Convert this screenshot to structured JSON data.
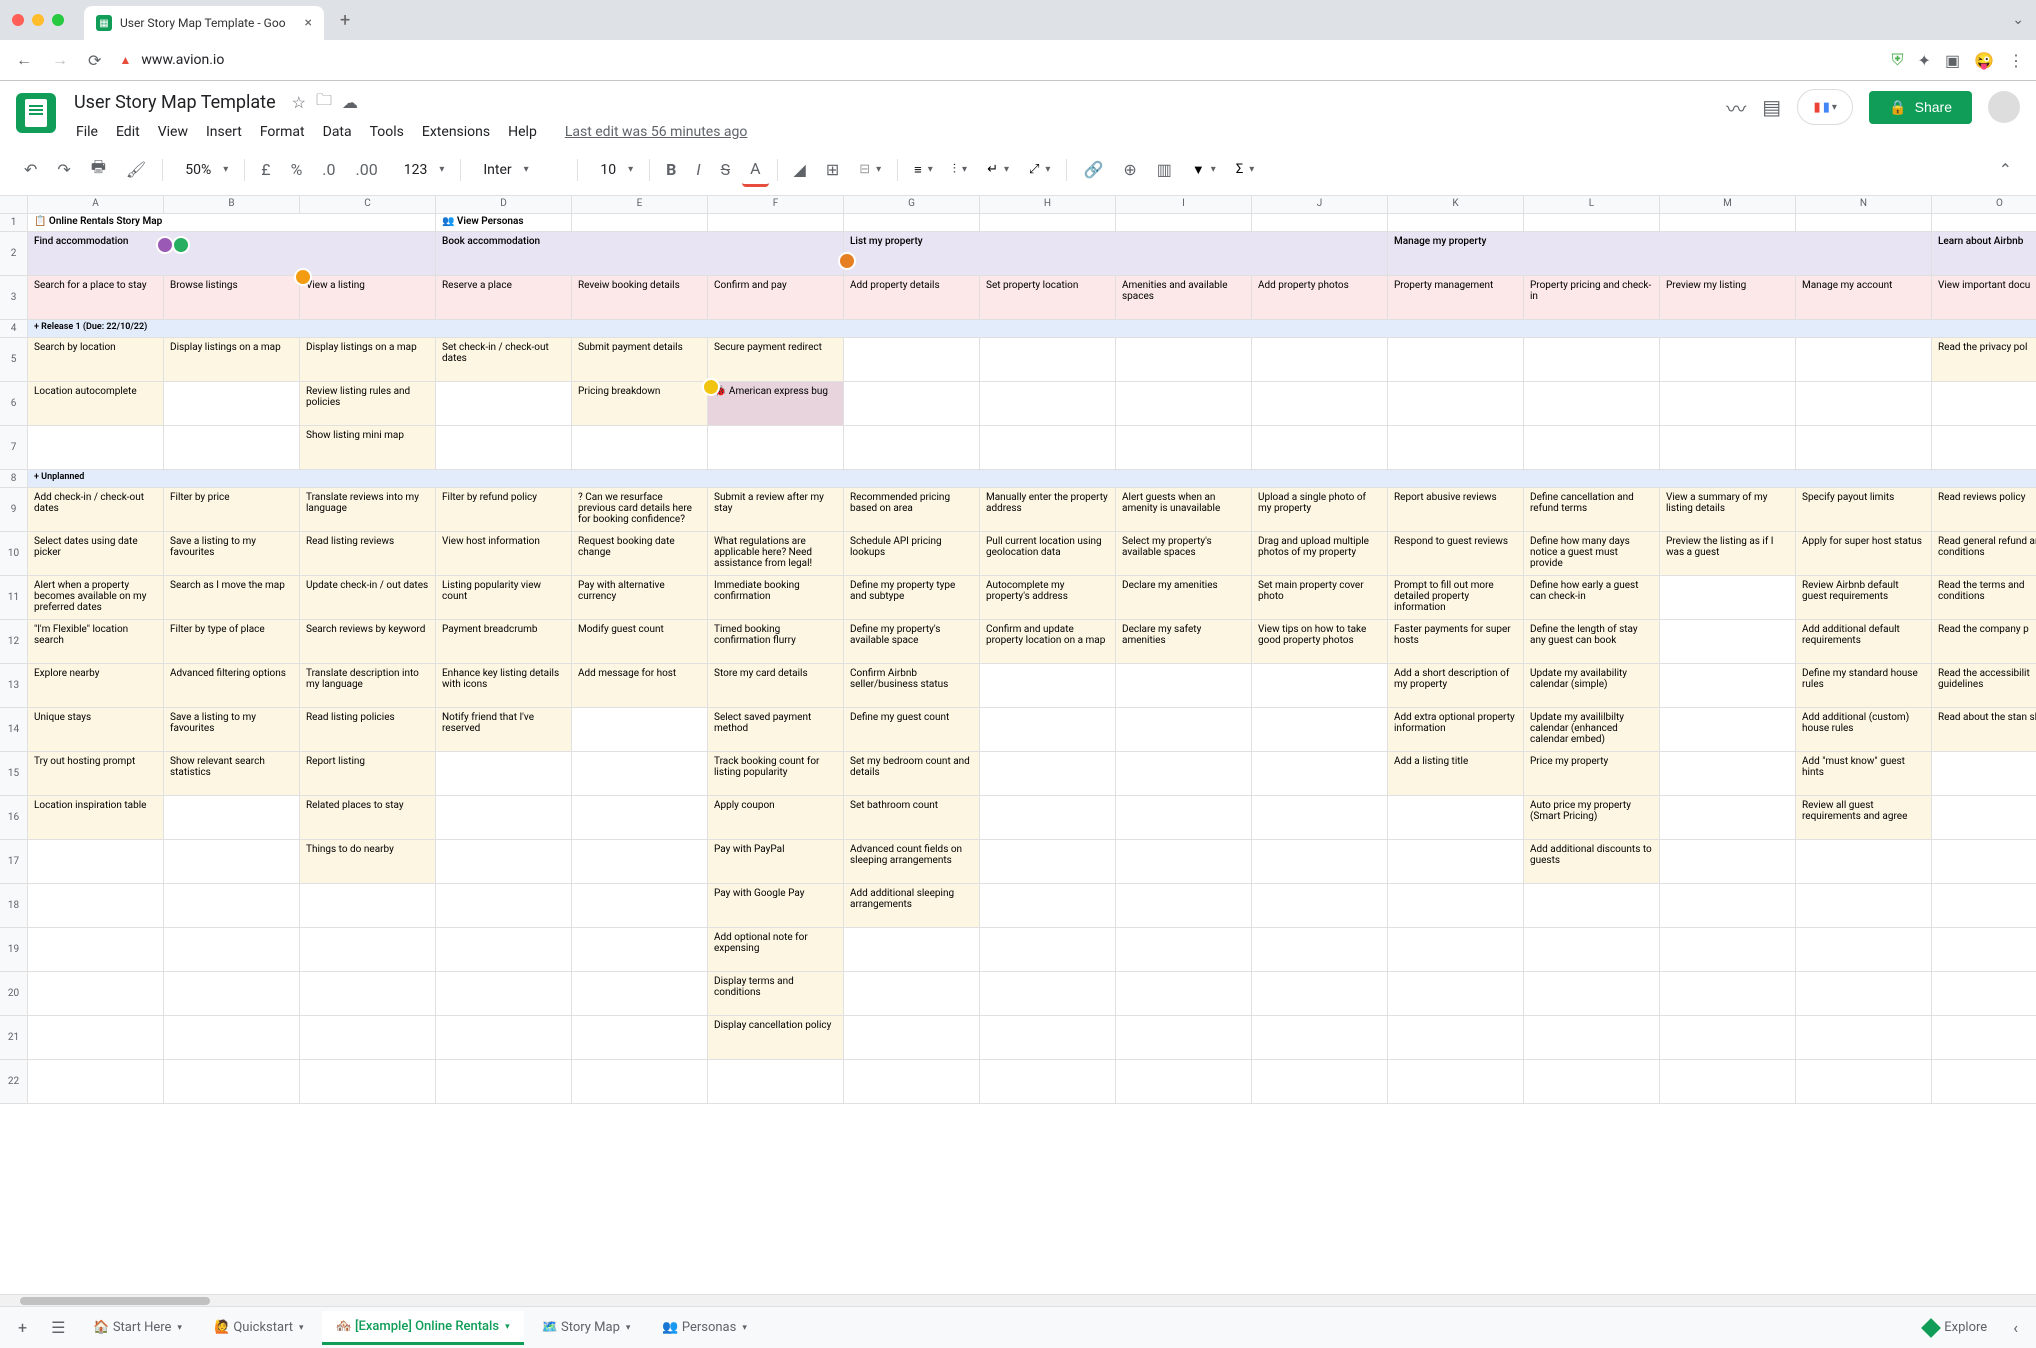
{
  "browser": {
    "tab_title": "User Story Map Template - Goo",
    "url": "www.avion.io"
  },
  "doc": {
    "title": "User Story Map Template",
    "last_edit": "Last edit was 56 minutes ago"
  },
  "menus": [
    "File",
    "Edit",
    "View",
    "Insert",
    "Format",
    "Data",
    "Tools",
    "Extensions",
    "Help"
  ],
  "share_label": "Share",
  "toolbar": {
    "zoom": "50%",
    "currency": "£",
    "percent": "%",
    "dec_dec": ".0",
    "inc_dec": ".00",
    "num123": "123",
    "font": "Inter",
    "size": "10"
  },
  "columns": [
    "A",
    "B",
    "C",
    "D",
    "E",
    "F",
    "G",
    "H",
    "I",
    "J",
    "K",
    "L",
    "M",
    "N",
    "O"
  ],
  "row1": {
    "A": "📋 Online Rentals Story Map",
    "D": "👥 View Personas"
  },
  "journeys": {
    "A": "Find accommodation",
    "D": "Book accommodation",
    "G": "List my property",
    "K": "Manage my property",
    "O": "Learn about Airbnb"
  },
  "steps": [
    "Search for a place to stay",
    "Browse listings",
    "View a listing",
    "Reserve a place",
    "Reveiw booking details",
    "Confirm and pay",
    "Add property details",
    "Set property location",
    "Amenities and available spaces",
    "Add property photos",
    "Property management",
    "Property pricing and check-in",
    "Preview my listing",
    "Manage my account",
    "View important docu"
  ],
  "release1": "+ Release 1 (Due: 22/10/22)",
  "r5": [
    "Search by location",
    "Display listings on a map",
    "Display listings on a map",
    "Set check-in / check-out dates",
    "Submit payment details",
    "Secure payment redirect",
    "",
    "",
    "",
    "",
    "",
    "",
    "",
    "",
    "Read the privacy pol"
  ],
  "r6": [
    "Location autocomplete",
    "",
    "Review listing rules and policies",
    "",
    "Pricing breakdown",
    "🐞 American express bug",
    "",
    "",
    "",
    "",
    "",
    "",
    "",
    "",
    ""
  ],
  "r7": [
    "",
    "",
    "Show listing mini map",
    "",
    "",
    "",
    "",
    "",
    "",
    "",
    "",
    "",
    "",
    "",
    ""
  ],
  "unplanned": "+ Unplanned",
  "r9": [
    "Add check-in / check-out dates",
    "Filter by price",
    "Translate reviews into my language",
    "Filter by refund policy",
    "? Can we resurface previous card details here for booking confidence?",
    "Submit a review after my stay",
    "Recommended pricing based on area",
    "Manually enter the property address",
    "Alert guests when an amenity is unavailable",
    "Upload a single photo of my property",
    "Report abusive reviews",
    "Define cancellation and refund terms",
    "View a summary of my listing details",
    "Specify payout limits",
    "Read reviews policy"
  ],
  "r10": [
    "Select dates using date picker",
    "Save a listing to my favourites",
    "Read listing reviews",
    "View host information",
    "Request booking date change",
    "What regulations are applicable here? Need assistance from legal!",
    "Schedule API pricing lookups",
    "Pull current location using geolocation data",
    "Select my property's available spaces",
    "Drag and upload multiple photos of my property",
    "Respond to guest reviews",
    "Define how many days notice a guest must provide",
    "Preview the listing as if I was a guest",
    "Apply for super host status",
    "Read general refund and conditions"
  ],
  "r11": [
    "Alert when a property becomes available on my preferred dates",
    "Search as I move the map",
    "Update check-in / out dates",
    "Listing popularity view count",
    "Pay with alternative currency",
    "Immediate booking confirmation",
    "Define my property type and subtype",
    "Autocomplete my property's address",
    "Declare my amenities",
    "Set main property cover photo",
    "Prompt to fill out more detailed property information",
    "Define how early a guest can check-in",
    "",
    "Review Airbnb default guest requirements",
    "Read the terms and conditions"
  ],
  "r12": [
    "\"I'm Flexible\" location search",
    "Filter by type of place",
    "Search reviews by keyword",
    "Payment breadcrumb",
    "Modify guest count",
    "Timed booking confirmation flurry",
    "Define my property's available space",
    "Confirm and update property location on a map",
    "Declare my safety amenities",
    "View tips on how to take good property photos",
    "Faster payments for super hosts",
    "Define the length of stay any guest can book",
    "",
    "Add additional default requirements",
    "Read the company p"
  ],
  "r13": [
    "Explore nearby",
    "Advanced filtering options",
    "Translate description into my language",
    "Enhance key listing details with icons",
    "Add message for host",
    "Store my card details",
    "Confirm Airbnb seller/business status",
    "",
    "",
    "",
    "Add a short description of my property",
    "Update my availability calendar (simple)",
    "",
    "Define my standard house rules",
    "Read the accessibilit guidelines"
  ],
  "r14": [
    "Unique stays",
    "Save a listing to my favourites",
    "Read listing policies",
    "Notify friend that I've reserved",
    "",
    "Select saved payment method",
    "Define my guest count",
    "",
    "",
    "",
    "Add extra optional property information",
    "Update my availilbilty calendar (enhanced calendar embed)",
    "",
    "Add additional (custom) house rules",
    "Read about the stan slavery"
  ],
  "r15": [
    "Try out hosting prompt",
    "Show relevant search statistics",
    "Report listing",
    "",
    "",
    "Track booking count for listing popularity",
    "Set my bedroom count and details",
    "",
    "",
    "",
    "Add a listing title",
    "Price my property",
    "",
    "Add \"must know\" guest hints",
    ""
  ],
  "r16": [
    "Location inspiration table",
    "",
    "Related places to stay",
    "",
    "",
    "Apply coupon",
    "Set bathroom count",
    "",
    "",
    "",
    "",
    "Auto price my property (Smart Pricing)",
    "",
    "Review all guest requirements and agree",
    ""
  ],
  "r17": [
    "",
    "",
    "Things to do nearby",
    "",
    "",
    "Pay with PayPal",
    "Advanced count fields on sleeping arrangements",
    "",
    "",
    "",
    "",
    "Add additional discounts to guests",
    "",
    "",
    ""
  ],
  "r18": [
    "",
    "",
    "",
    "",
    "",
    "Pay with Google Pay",
    "Add additional sleeping arrangements",
    "",
    "",
    "",
    "",
    "",
    "",
    "",
    ""
  ],
  "r19": [
    "",
    "",
    "",
    "",
    "",
    "Add optional note for expensing",
    "",
    "",
    "",
    "",
    "",
    "",
    "",
    "",
    ""
  ],
  "r20": [
    "",
    "",
    "",
    "",
    "",
    "Display terms and conditions",
    "",
    "",
    "",
    "",
    "",
    "",
    "",
    "",
    ""
  ],
  "r21": [
    "",
    "",
    "",
    "",
    "",
    "Display cancellation policy",
    "",
    "",
    "",
    "",
    "",
    "",
    "",
    "",
    ""
  ],
  "sheet_tabs": [
    "🏠 Start Here",
    "🙋 Quickstart",
    "🏘️ [Example] Online Rentals",
    "🗺️ Story Map",
    "👥 Personas"
  ],
  "explore": "Explore"
}
